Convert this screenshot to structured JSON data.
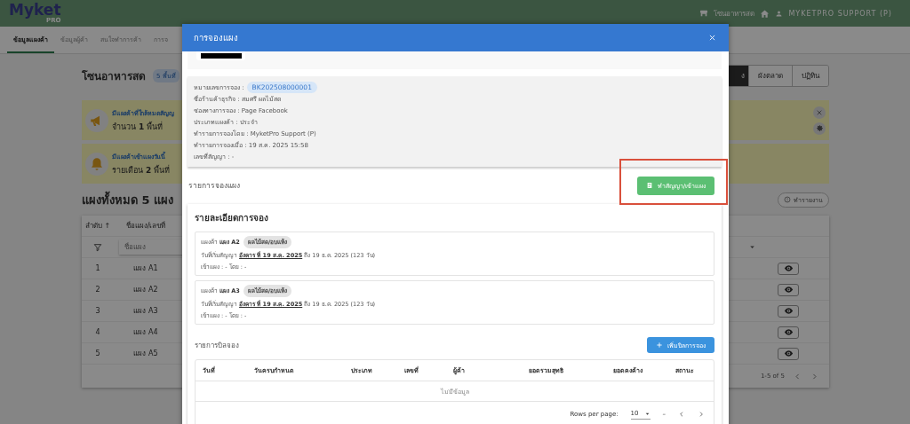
{
  "app_header": {
    "logo": "Myket",
    "logo_sub": "PRO",
    "zone": "โซนอาหารสด",
    "user": "MYKETPRO SUPPORT (P)"
  },
  "nav_tabs": [
    {
      "label": "ข้อมูลแผงค้า",
      "selected": true
    },
    {
      "label": "ข้อมูลผู้ค้า",
      "selected": false
    },
    {
      "label": "สนใจทำการค้า",
      "selected": false
    },
    {
      "label": "การจ",
      "selected": false
    }
  ],
  "zone_title": "โซนอาหารสด",
  "zone_badge": "5 พื้นที่",
  "view_buttons": [
    {
      "label": "ง",
      "selected": true
    },
    {
      "label": "ผังตลาด",
      "selected": false
    },
    {
      "label": "ปฏิทิน",
      "selected": false
    }
  ],
  "alerts": [
    {
      "kind": "megaphone",
      "title": "มีแผงค้าที่ใกล้หมดสัญญ",
      "text": "จำนวน **1** พื้นที่"
    },
    {
      "kind": "bell",
      "title": "มีแผงค้าเข้าแผงวันนี้",
      "text": "รายเดือน **2** พื้นที่"
    }
  ],
  "stalls_heading": "แผงทั้งหมด 5 แผง",
  "report_button": "ทำรายงาน",
  "stall_table": {
    "columns": [
      "ลำดับ ↑",
      "ชื่อแผง/เลขที่"
    ],
    "filter_placeholder": "ชื่อแผง",
    "rows": [
      {
        "index": "1",
        "name": "แผง A1"
      },
      {
        "index": "2",
        "name": "แผง A2"
      },
      {
        "index": "3",
        "name": "แผง A3"
      },
      {
        "index": "4",
        "name": "แผง A4"
      },
      {
        "index": "5",
        "name": "แผง A5"
      }
    ],
    "pagination": "1-5 of 5"
  },
  "modal": {
    "title": "การจองแผง",
    "booking_no_label": "หมายเลขการจอง :",
    "booking_no": "BK202508000001",
    "details": [
      "ชื่อร้านค้าธุรกิจ : สมศรี ผลไม้สด",
      "ช่องทางการจอง : Page Facebook",
      "ประเภทแผงค้า : ประจำ",
      "ทำรายการจองโดย : MyketPro Support (P)",
      "ทำรายการจองเมื่อ : 19 ส.ค. 2025 15:58",
      "เลขที่สัญญา : -"
    ],
    "section_title": "รายการจองแผง",
    "contract_button": "ทำสัญญา/เข้าแผง",
    "detail_title": "รายละเอียดการจอง",
    "bookings": [
      {
        "stall": "แผงค้า **แผง A2**",
        "category": "ผลไม้สด/อบแห้ง",
        "period": "วันที่เริ่มสัญญา **อังคาร ที่ 19 ส.ค. 2025** ถึง 19 ธ.ค. 2025 (123 วัน)",
        "entry": "เข้าแผง : - โดย : -"
      },
      {
        "stall": "แผงค้า **แผง A3**",
        "category": "ผลไม้สด/อบแห้ง",
        "period": "วันที่เริ่มสัญญา **อังคาร ที่ 19 ส.ค. 2025** ถึง 19 ธ.ค. 2025 (123 วัน)",
        "entry": "เข้าแผง : - โดย : -"
      }
    ],
    "bills_title": "รายการบิลจอง",
    "add_bill_button": "เพิ่มบิลการจอง",
    "bill_table": {
      "columns": [
        "วันที่",
        "วันครบกำหนด",
        "ประเภท",
        "เลขที่",
        "ผู้ค้า",
        "ยอดรวมสุทธิ",
        "ยอดคงค้าง",
        "สถานะ"
      ],
      "empty": "ไม่มีข้อมูล",
      "rows_per_page_label": "Rows per page:",
      "rows_per_page": "10",
      "range": "–"
    }
  }
}
